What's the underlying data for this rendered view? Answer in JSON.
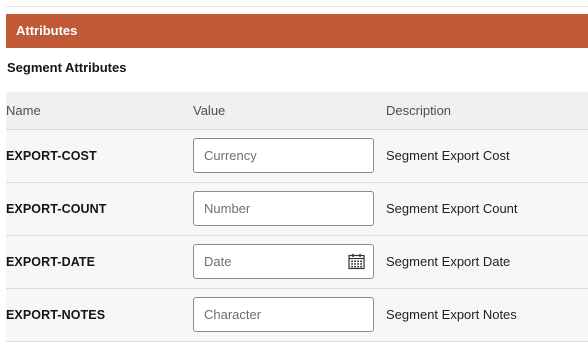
{
  "section": {
    "title": "Attributes"
  },
  "subsection": {
    "title": "Segment Attributes"
  },
  "table": {
    "headers": {
      "name": "Name",
      "value": "Value",
      "description": "Description"
    },
    "rows": [
      {
        "name": "EXPORT-COST",
        "value": "",
        "placeholder": "Currency",
        "description": "Segment Export Cost",
        "icon": null
      },
      {
        "name": "EXPORT-COUNT",
        "value": "",
        "placeholder": "Number",
        "description": "Segment Export Count",
        "icon": null
      },
      {
        "name": "EXPORT-DATE",
        "value": "",
        "placeholder": "Date",
        "description": "Segment Export Date",
        "icon": "calendar-icon"
      },
      {
        "name": "EXPORT-NOTES",
        "value": "",
        "placeholder": "Character",
        "description": "Segment Export Notes",
        "icon": null
      }
    ]
  },
  "colors": {
    "header_accent": "#c05a36",
    "table_header_bg": "#f1f0ee",
    "table_row_bg": "#f7f7f6",
    "input_border": "#8b8b8b"
  }
}
